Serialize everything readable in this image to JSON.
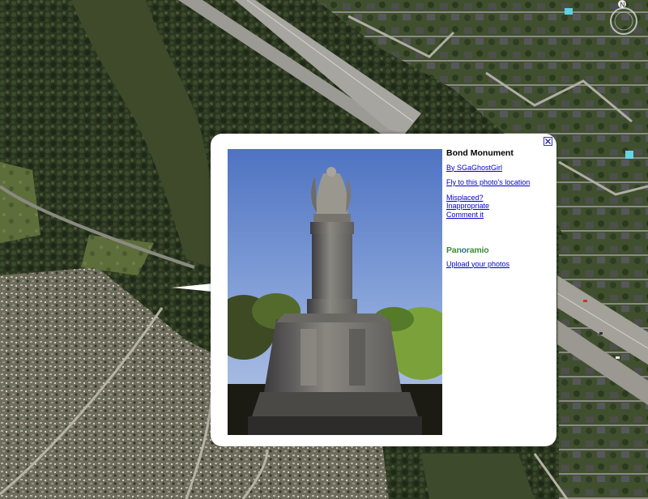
{
  "popup": {
    "title": "Bond Monument",
    "author_link": "By SGaGhostGirl",
    "fly_link": "Fly to this photo's location",
    "misplaced_link": "Misplaced?",
    "inappropriate_link": "Inappropriate",
    "comment_link": "Comment it",
    "brand_prefix": "Pan",
    "brand_mid": "o",
    "brand_suffix": "ramio",
    "upload_link": "Upload your photos",
    "close_icon": "close-x-icon"
  },
  "compass": {
    "north_label": "N"
  },
  "colors": {
    "link": "#0000cc",
    "brand_green": "#3d8a37",
    "brand_blue": "#1e6cc6",
    "river": "#3f4a2a",
    "forest": "#2c3a1f"
  }
}
